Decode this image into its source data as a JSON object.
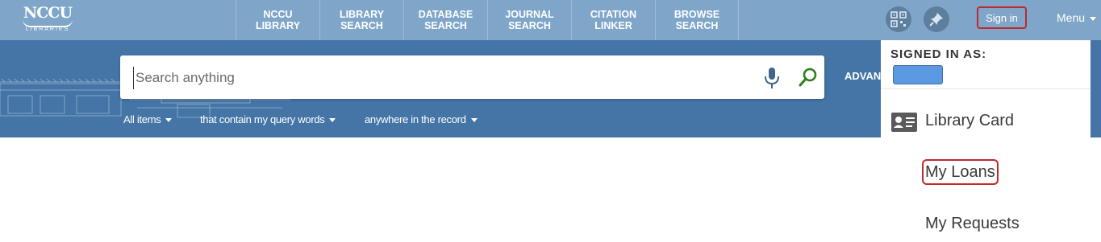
{
  "header": {
    "logo": {
      "main": "NCCU",
      "sub": "LIBRARIES"
    },
    "nav": [
      {
        "label": "NCCU\nLIBRARY"
      },
      {
        "label": "LIBRARY\nSEARCH"
      },
      {
        "label": "DATABASE\nSEARCH"
      },
      {
        "label": "JOURNAL\nSEARCH"
      },
      {
        "label": "CITATION\nLINKER"
      },
      {
        "label": "BROWSE\nSEARCH"
      }
    ],
    "icons": {
      "qr": "qr-code-icon",
      "pin": "pin-icon"
    },
    "sign_in": "Sign in",
    "menu": "Menu"
  },
  "search": {
    "placeholder": "Search anything",
    "value": "",
    "advanced_label": "ADVAN",
    "scopes": [
      {
        "label": "All items"
      },
      {
        "label": "that contain my query words"
      },
      {
        "label": "anywhere in the record"
      }
    ]
  },
  "user_menu": {
    "signed_in_label": "SIGNED IN AS:",
    "items": [
      {
        "label": "Library Card",
        "icon": "id-card-icon"
      },
      {
        "label": "My Loans"
      },
      {
        "label": "My Requests"
      }
    ]
  },
  "colors": {
    "topbar": "#7fa6c9",
    "hero": "#4475a6",
    "highlight": "#c0282d",
    "search_go": "#2e7d1f"
  }
}
